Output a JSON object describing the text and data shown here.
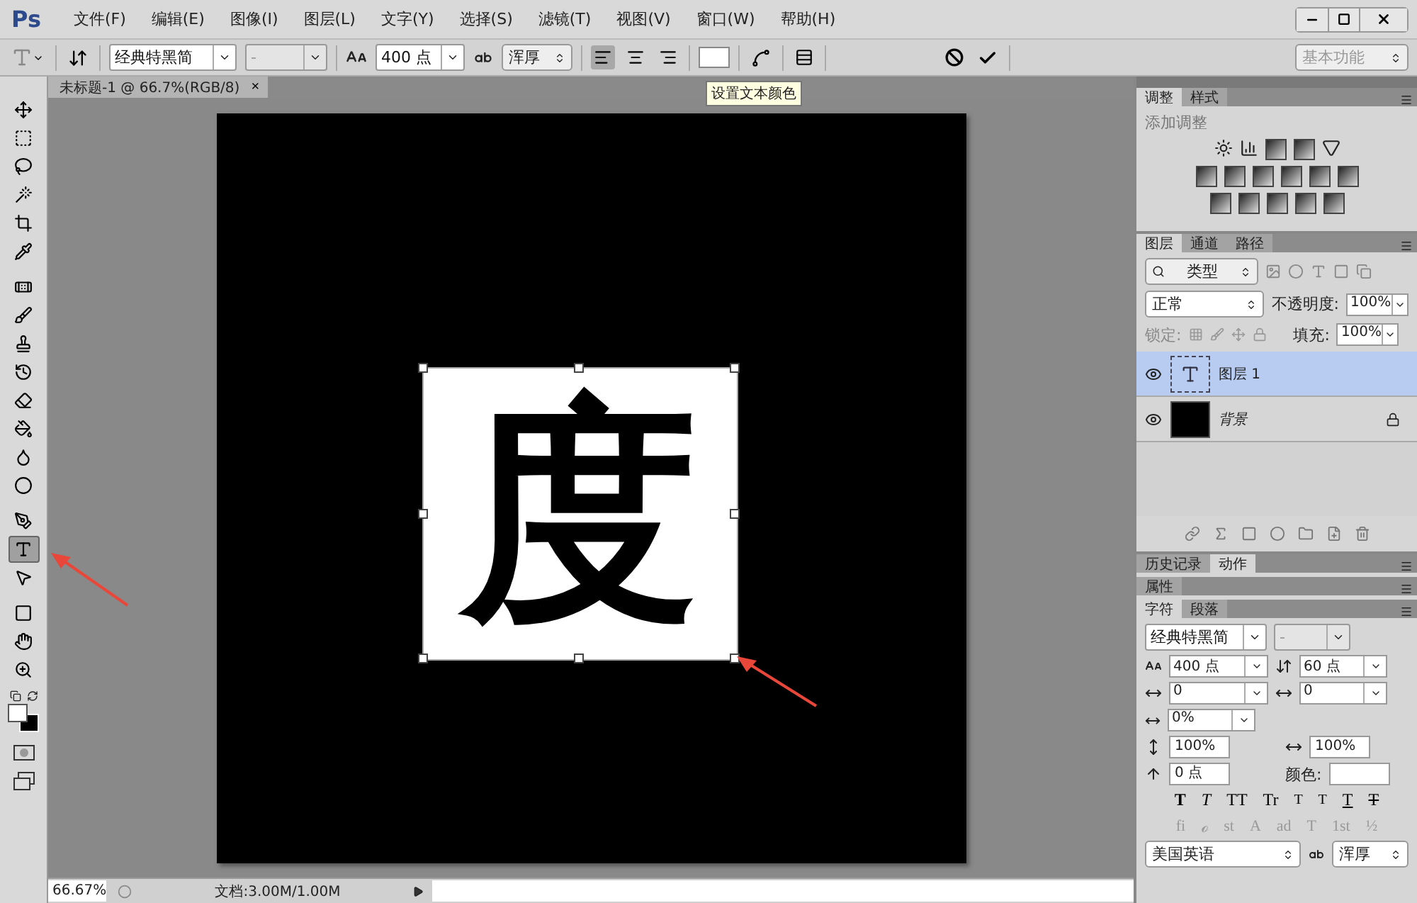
{
  "app_logo": "Ps",
  "menu": [
    "文件(F)",
    "编辑(E)",
    "图像(I)",
    "图层(L)",
    "文字(Y)",
    "选择(S)",
    "滤镜(T)",
    "视图(V)",
    "窗口(W)",
    "帮助(H)"
  ],
  "options_bar": {
    "font_family": "经典特黑简",
    "font_style": "-",
    "font_size": "400 点",
    "antialias": "浑厚",
    "alignment": [
      {
        "kind": "left",
        "selected": true
      },
      {
        "kind": "center",
        "selected": false
      },
      {
        "kind": "right",
        "selected": false
      }
    ],
    "workspace": "基本功能"
  },
  "tooltip": "设置文本颜色",
  "document_tab": {
    "title": "未标题-1 @ 66.7%(RGB/8)",
    "close": "×"
  },
  "tools": [
    {
      "kind": "move",
      "selected": false
    },
    {
      "kind": "marquee",
      "selected": false
    },
    {
      "kind": "lasso",
      "selected": false
    },
    {
      "kind": "quick-select",
      "selected": false
    },
    {
      "kind": "crop",
      "selected": false
    },
    {
      "kind": "eyedropper",
      "selected": false
    },
    {
      "kind": "heal",
      "selected": false
    },
    {
      "kind": "brush",
      "selected": false
    },
    {
      "kind": "stamp",
      "selected": false
    },
    {
      "kind": "history-brush",
      "selected": false
    },
    {
      "kind": "eraser",
      "selected": false
    },
    {
      "kind": "bucket",
      "selected": false
    },
    {
      "kind": "blur",
      "selected": false
    },
    {
      "kind": "dodge",
      "selected": false
    },
    {
      "kind": "pen",
      "selected": false
    },
    {
      "kind": "type",
      "selected": true
    },
    {
      "kind": "path-select",
      "selected": false
    },
    {
      "kind": "rectangle",
      "selected": false
    },
    {
      "kind": "hand",
      "selected": false
    },
    {
      "kind": "zoom",
      "selected": false
    }
  ],
  "canvas": {
    "glyph": "度"
  },
  "adjustments_panel": {
    "tabs": [
      {
        "label": "调整",
        "selected": true
      },
      {
        "label": "样式",
        "selected": false
      }
    ],
    "heading": "添加调整"
  },
  "layers_panel": {
    "tabs": [
      {
        "label": "图层",
        "selected": true
      },
      {
        "label": "通道",
        "selected": false
      },
      {
        "label": "路径",
        "selected": false
      }
    ],
    "filter": "类型",
    "blend_mode": "正常",
    "opacity_label": "不透明度:",
    "opacity": "100%",
    "lock_label": "锁定:",
    "fill_label": "填充:",
    "fill": "100%",
    "layers": [
      {
        "name": "图层 1",
        "kind": "text",
        "selected": true,
        "locked": false
      },
      {
        "name": "背景",
        "kind": "fill",
        "selected": false,
        "locked": true
      }
    ]
  },
  "history_panel": {
    "tabs": [
      {
        "label": "历史记录",
        "selected": false
      },
      {
        "label": "动作",
        "selected": true
      }
    ]
  },
  "properties_panel": {
    "title": "属性"
  },
  "character_panel": {
    "tabs": [
      {
        "label": "字符",
        "selected": true
      },
      {
        "label": "段落",
        "selected": false
      }
    ],
    "font_family": "经典特黑简",
    "font_style": "-",
    "font_size": "400 点",
    "leading": "60 点",
    "kerning": "0",
    "tracking": "0",
    "tsume": "0%",
    "vertical_scale": "100%",
    "horizontal_scale": "100%",
    "baseline_shift": "0 点",
    "color_label": "颜色:",
    "style_buttons": [
      {
        "label": "T",
        "kind": "bold"
      },
      {
        "label": "T",
        "kind": "italic"
      },
      {
        "label": "TT",
        "kind": "caps"
      },
      {
        "label": "Tr",
        "kind": "smallcaps"
      },
      {
        "label": "T",
        "kind": "super"
      },
      {
        "label": "T",
        "kind": "sub"
      },
      {
        "label": "T",
        "kind": "underline"
      },
      {
        "label": "T",
        "kind": "strike"
      }
    ],
    "opentype_buttons": [
      "fi",
      "ℴ",
      "st",
      "A",
      "ad",
      "T",
      "1st",
      "½"
    ],
    "language": "美国英语",
    "antialias": "浑厚"
  },
  "status_bar": {
    "zoom": "66.67%",
    "doc_info": "文档:3.00M/1.00M"
  }
}
